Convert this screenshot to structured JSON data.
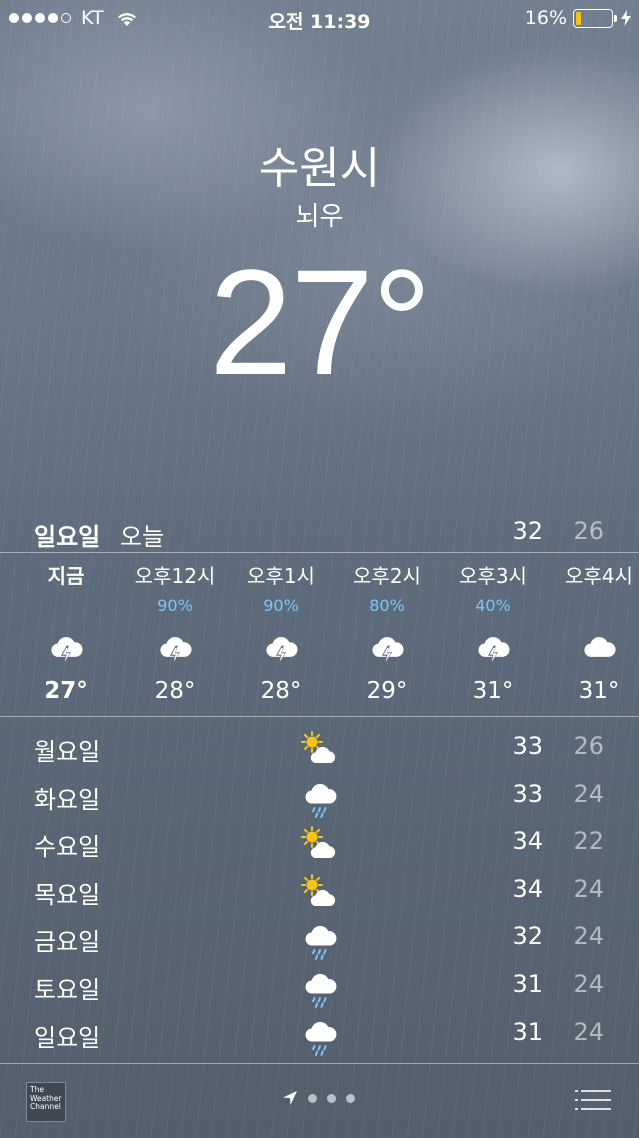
{
  "status_bar": {
    "carrier": "KT",
    "time": "오전 11:39",
    "battery_percent": "16%",
    "battery_level": 0.16,
    "signal_bars_filled": 4
  },
  "location": {
    "city": "수원시",
    "condition": "뇌우",
    "temperature": "27°"
  },
  "today": {
    "day": "일요일",
    "label": "오늘",
    "high": "32",
    "low": "26"
  },
  "hourly": [
    {
      "time": "지금",
      "precip": "",
      "icon": "thunderstorm-icon",
      "temp": "27°",
      "bold": true
    },
    {
      "time": "오후12시",
      "precip": "90%",
      "icon": "thunderstorm-icon",
      "temp": "28°"
    },
    {
      "time": "오후1시",
      "precip": "90%",
      "icon": "thunderstorm-icon",
      "temp": "28°"
    },
    {
      "time": "오후2시",
      "precip": "80%",
      "icon": "thunderstorm-icon",
      "temp": "29°"
    },
    {
      "time": "오후3시",
      "precip": "40%",
      "icon": "thunderstorm-icon",
      "temp": "31°"
    },
    {
      "time": "오후4시",
      "precip": "",
      "icon": "cloud-icon",
      "temp": "31°"
    }
  ],
  "daily": [
    {
      "day": "월요일",
      "icon": "partly-sunny-icon",
      "high": "33",
      "low": "26"
    },
    {
      "day": "화요일",
      "icon": "rain-icon",
      "high": "33",
      "low": "24"
    },
    {
      "day": "수요일",
      "icon": "partly-sunny-icon",
      "high": "34",
      "low": "22"
    },
    {
      "day": "목요일",
      "icon": "partly-sunny-icon",
      "high": "34",
      "low": "24"
    },
    {
      "day": "금요일",
      "icon": "rain-icon",
      "high": "32",
      "low": "24"
    },
    {
      "day": "토요일",
      "icon": "rain-icon",
      "high": "31",
      "low": "24"
    },
    {
      "day": "일요일",
      "icon": "rain-icon",
      "high": "31",
      "low": "24"
    }
  ],
  "footer": {
    "logo_text": "The Weather Channel",
    "pages": 3
  },
  "colors": {
    "precip": "#79c6f7",
    "sun": "#f7c51a",
    "battery": "#f2c311"
  }
}
